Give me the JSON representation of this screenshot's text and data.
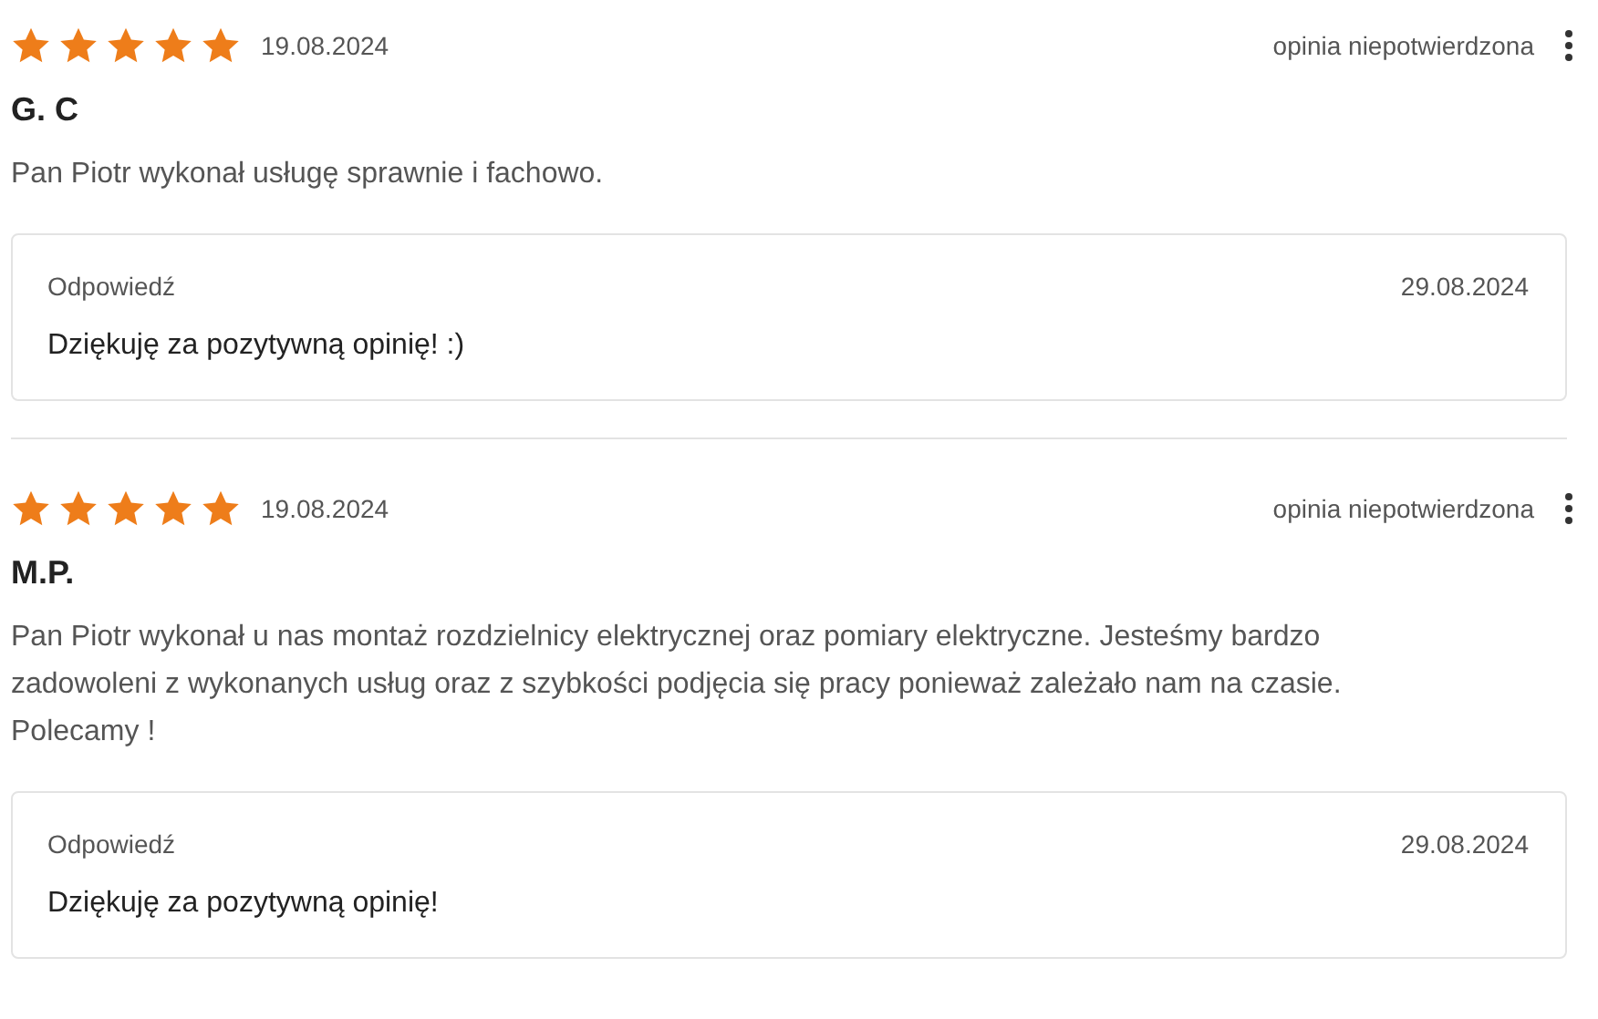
{
  "reviews": [
    {
      "stars": 5,
      "date": "19.08.2024",
      "status": "opinia niepotwierdzona",
      "author": "G. C",
      "text": "Pan Piotr wykonał usługę sprawnie i fachowo.",
      "reply": {
        "label": "Odpowiedź",
        "date": "29.08.2024",
        "text": "Dziękuję za pozytywną opinię! :)"
      }
    },
    {
      "stars": 5,
      "date": "19.08.2024",
      "status": "opinia niepotwierdzona",
      "author": "M.P.",
      "text": "Pan Piotr wykonał u nas montaż rozdzielnicy elektrycznej oraz pomiary elektryczne. Jesteśmy bardzo zadowoleni z wykonanych usług oraz z szybkości podjęcia się pracy ponieważ zależało nam na czasie. Polecamy !",
      "reply": {
        "label": "Odpowiedź",
        "date": "29.08.2024",
        "text": "Dziękuję za pozytywną opinię!"
      }
    }
  ]
}
